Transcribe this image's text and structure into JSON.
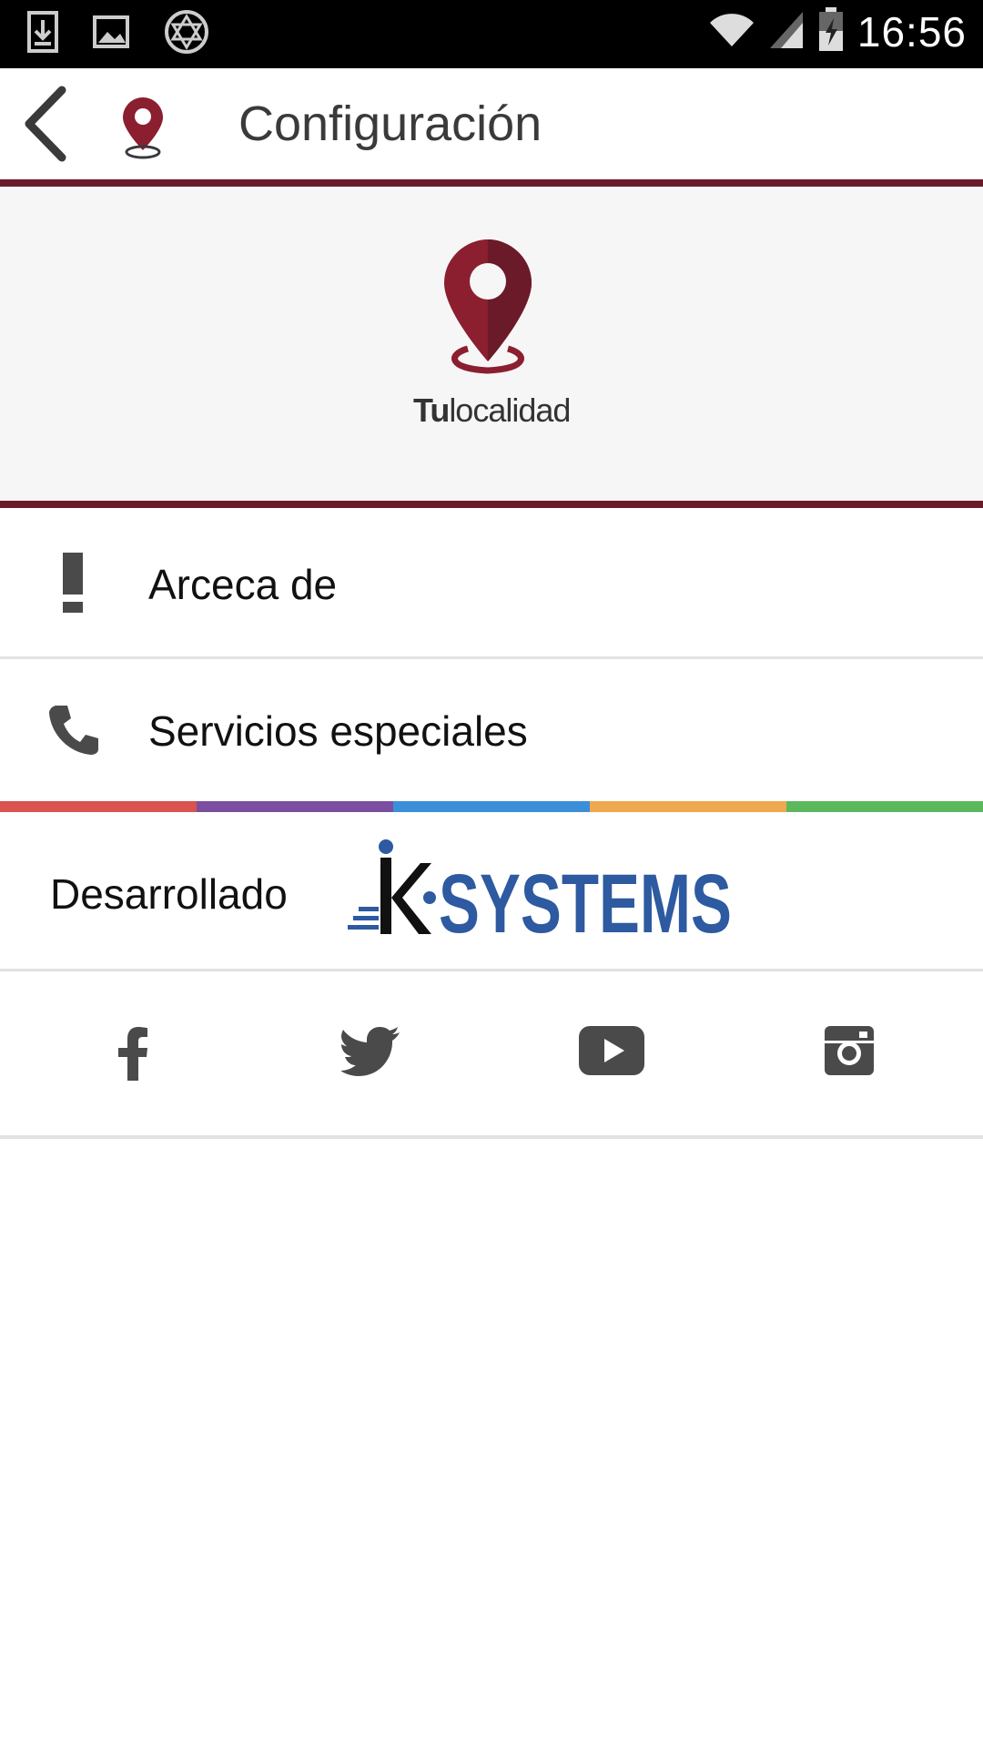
{
  "status_bar": {
    "time": "16:56"
  },
  "app_bar": {
    "title": "Configuración"
  },
  "hero": {
    "brand_bold": "Tu",
    "brand_rest": "localidad"
  },
  "menu": [
    {
      "label": "Arceca de",
      "icon": "exclamation-icon"
    },
    {
      "label": "Servicios especiales",
      "icon": "phone-icon"
    }
  ],
  "developer": {
    "label": "Desarrollado",
    "logo_text": "SYSTEMS",
    "logo_prefix": "K"
  },
  "social": [
    {
      "name": "facebook-icon"
    },
    {
      "name": "twitter-icon"
    },
    {
      "name": "youtube-icon"
    },
    {
      "name": "instagram-icon"
    }
  ],
  "colors": {
    "accent": "#6b1a2a",
    "pin": "#8b1f2f",
    "bar": [
      "#d9534f",
      "#7b4ea0",
      "#3b8fd8",
      "#efa84f",
      "#5cb85c"
    ],
    "systems_blue": "#2d5aa0"
  }
}
